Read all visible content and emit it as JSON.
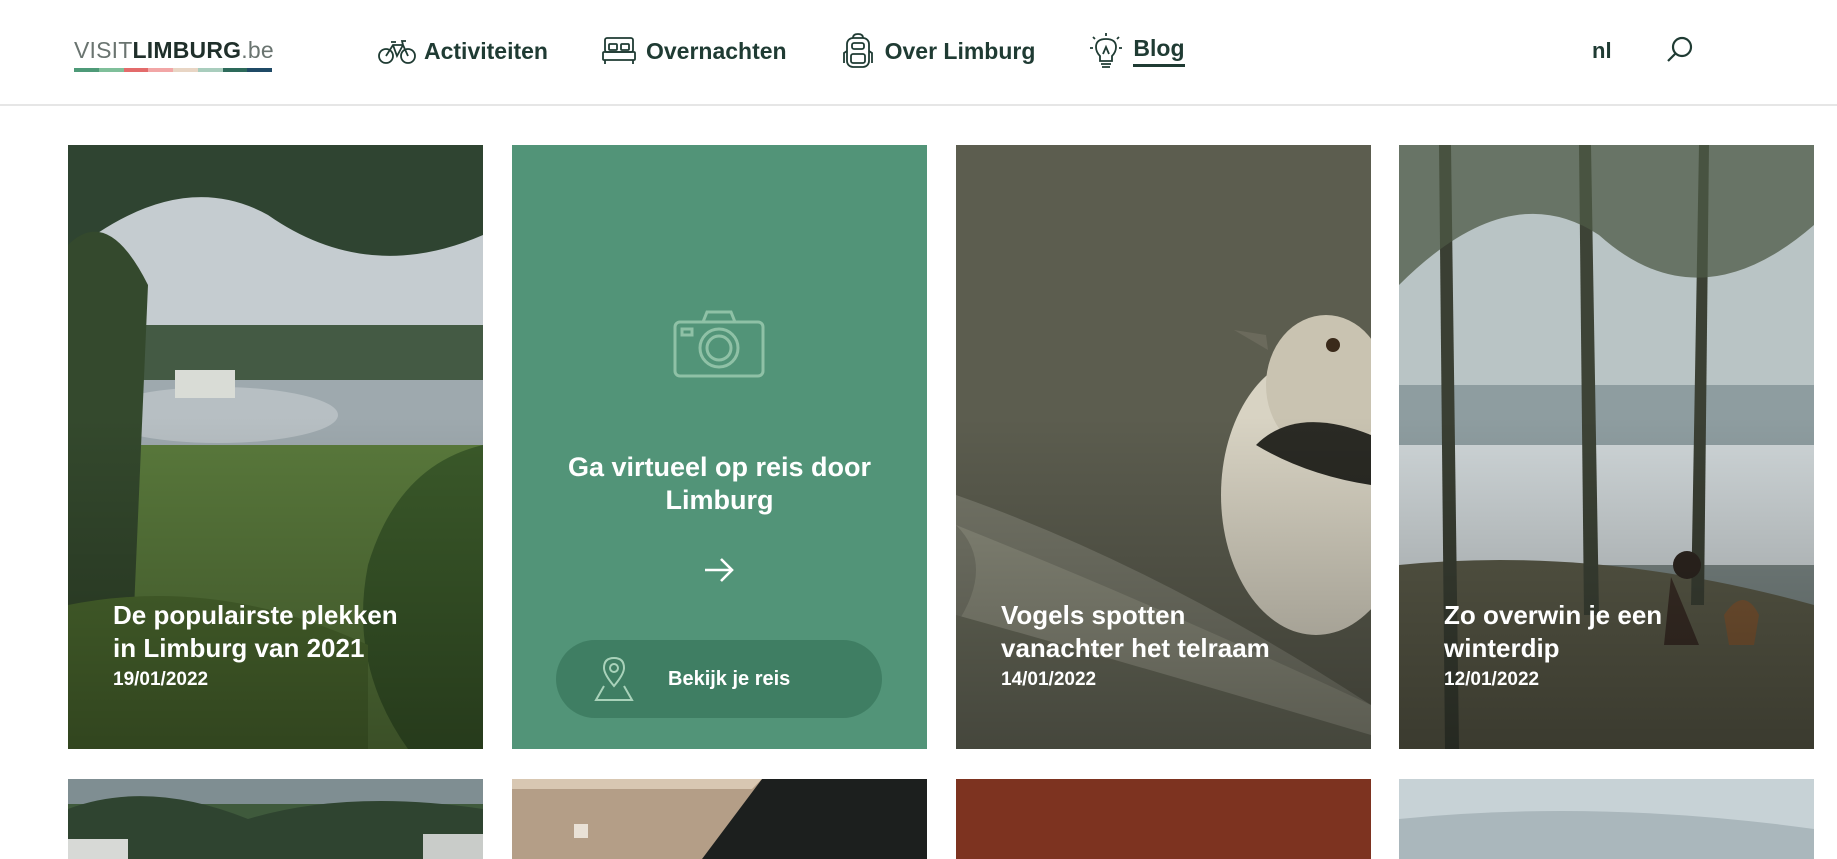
{
  "header": {
    "logo": {
      "visit": "VISIT",
      "limburg": "LIMBURG",
      "tld": ".be",
      "stripe_colors": [
        "#4e9a78",
        "#7fbf9a",
        "#e36b6b",
        "#f2a6a6",
        "#e8d5c4",
        "#a9cdbd",
        "#2d6a5a",
        "#1f4a66"
      ]
    },
    "nav": [
      {
        "label": "Activiteiten",
        "icon": "bicycle-icon"
      },
      {
        "label": "Overnachten",
        "icon": "bed-icon"
      },
      {
        "label": "Over Limburg",
        "icon": "backpack-icon"
      },
      {
        "label": "Blog",
        "icon": "lightbulb-icon",
        "active": true
      }
    ],
    "language": "nl",
    "search_icon": "search-icon"
  },
  "cards": [
    {
      "title": "De populairste plekken in Limburg van 2021",
      "date": "19/01/2022"
    },
    {
      "title": "Vogels spotten vanachter het telraam",
      "date": "14/01/2022"
    },
    {
      "title": "Zo overwin je een winterdip",
      "date": "12/01/2022"
    }
  ],
  "promo": {
    "title": "Ga virtueel op reis door Limburg",
    "button_label": "Bekijk je reis",
    "icons": [
      "camera-icon",
      "arrow-right-icon",
      "map-pin-icon"
    ]
  },
  "colors": {
    "brand_green": "#529478",
    "brand_green_dark": "#3f7e63",
    "text_dark": "#1f3b33"
  }
}
